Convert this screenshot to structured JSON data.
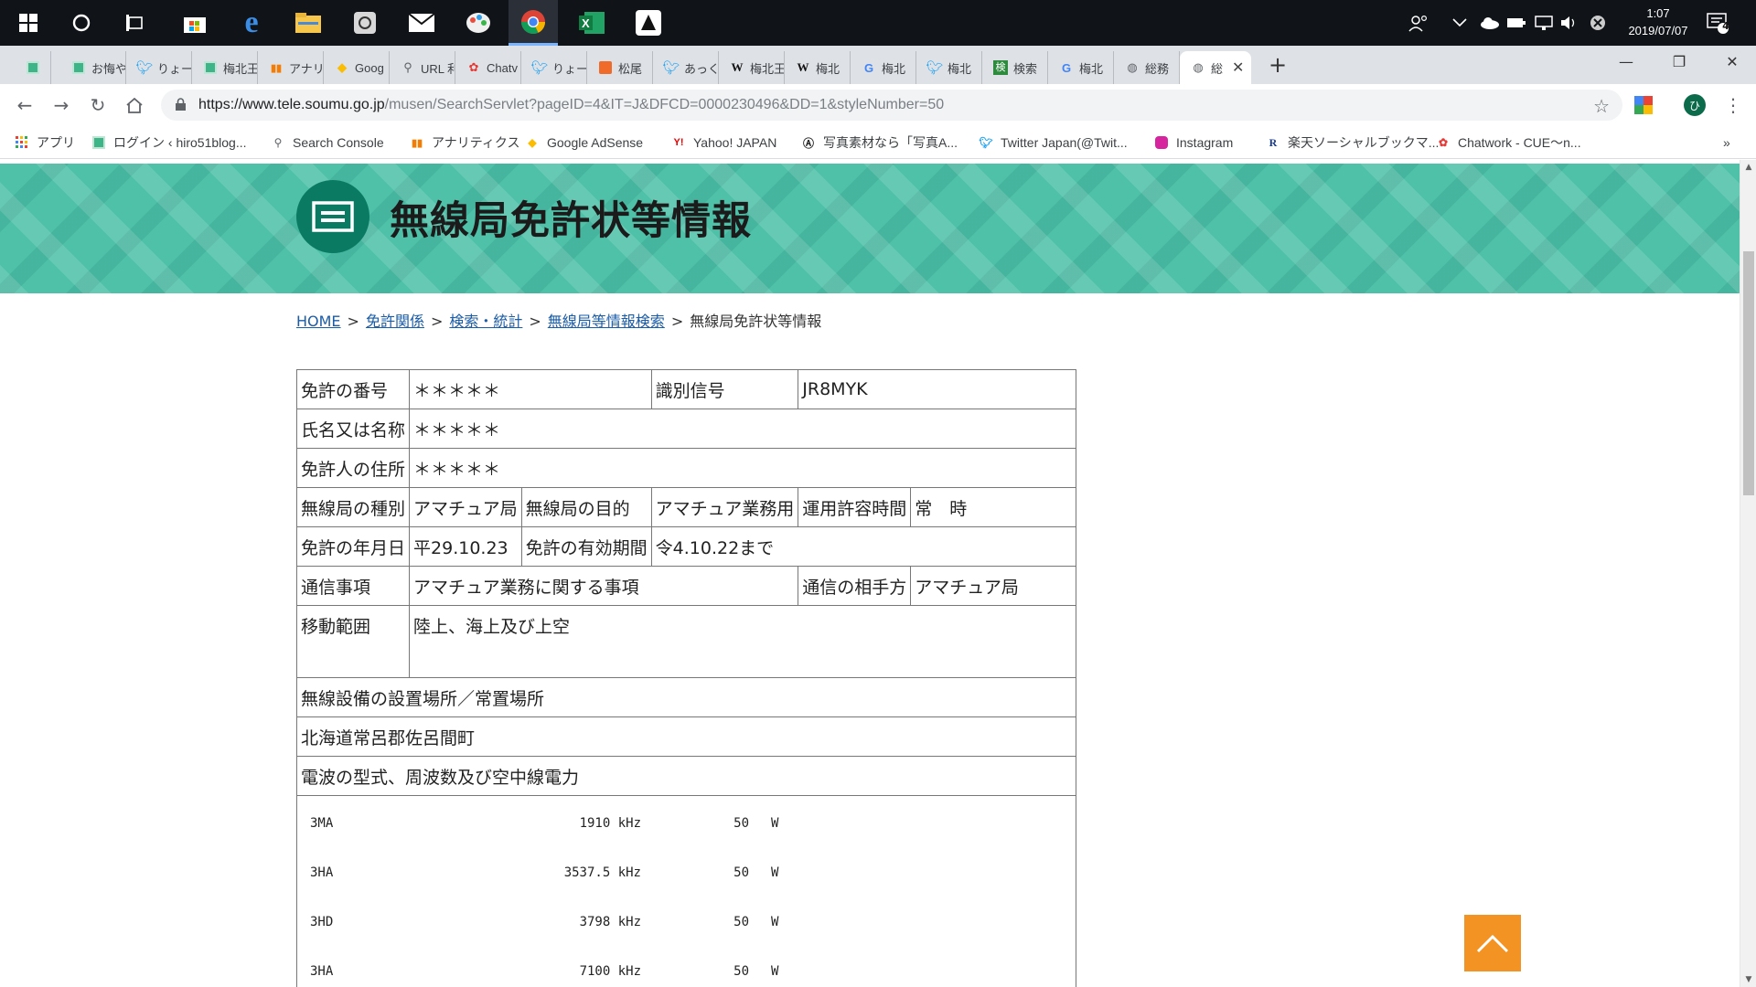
{
  "taskbar": {
    "clock_time": "1:07",
    "clock_date": "2019/07/07",
    "notification_count": "4",
    "apps": [
      "windows-start",
      "cortana",
      "task-view",
      "store",
      "edge",
      "explorer",
      "snipping",
      "mail",
      "paint",
      "chrome",
      "excel",
      "app"
    ]
  },
  "browser": {
    "tabs": [
      {
        "label": "",
        "icon": "green-square"
      },
      {
        "label": "お悔や",
        "icon": "green-square"
      },
      {
        "label": "りょーさ",
        "icon": "twitter"
      },
      {
        "label": "梅北王",
        "icon": "green-square"
      },
      {
        "label": "アナリテ",
        "icon": "analytics"
      },
      {
        "label": "Goog",
        "icon": "adsense"
      },
      {
        "label": "URL 利",
        "icon": "search-console"
      },
      {
        "label": "Chatv",
        "icon": "chatwork"
      },
      {
        "label": "りょー(",
        "icon": "twitter"
      },
      {
        "label": "松尾",
        "icon": "orange"
      },
      {
        "label": "あっく/",
        "icon": "twitter"
      },
      {
        "label": "梅北王",
        "icon": "wikipedia"
      },
      {
        "label": "梅北",
        "icon": "wikipedia"
      },
      {
        "label": "梅北",
        "icon": "google"
      },
      {
        "label": "梅北",
        "icon": "twitter"
      },
      {
        "label": "検索",
        "icon": "kensaku"
      },
      {
        "label": "梅北",
        "icon": "google"
      },
      {
        "label": "総務",
        "icon": "globe"
      },
      {
        "label": "総",
        "icon": "globe",
        "active": true
      }
    ],
    "new_tab_label": "+",
    "url_host": "https://www.tele.soumu.go.jp",
    "url_path": "/musen/SearchServlet?pageID=4&IT=J&DFCD=0000230496&DD=1&styleNumber=50",
    "profile_initial": "ひ",
    "bookmarks": [
      {
        "label": "アプリ",
        "icon": "apps"
      },
      {
        "label": "ログイン ‹ hiro51blog...",
        "icon": "green-square"
      },
      {
        "label": "Search Console",
        "icon": "search-console"
      },
      {
        "label": "アナリティクス",
        "icon": "analytics"
      },
      {
        "label": "Google AdSense",
        "icon": "adsense"
      },
      {
        "label": "Yahoo! JAPAN",
        "icon": "yahoo"
      },
      {
        "label": "写真素材なら「写真A...",
        "icon": "photo"
      },
      {
        "label": "Twitter Japan(@Twit...",
        "icon": "twitter"
      },
      {
        "label": "Instagram",
        "icon": "instagram"
      },
      {
        "label": "楽天ソーシャルブックマ...",
        "icon": "rakuten"
      },
      {
        "label": "Chatwork - CUE～n...",
        "icon": "chatwork"
      }
    ],
    "bookmarks_more": "»"
  },
  "page": {
    "title": "無線局免許状等情報",
    "breadcrumb": {
      "home": "HOME",
      "sep": ">",
      "menkyo": "免許関係",
      "kensaku": "検索・統計",
      "musenkyoku": "無線局等情報検索",
      "current": "無線局免許状等情報"
    },
    "license": {
      "number_label": "免許の番号",
      "number_value": "＊＊＊＊＊",
      "callsign_label": "識別信号",
      "callsign_value": "JR8MYK",
      "name_label": "氏名又は名称",
      "name_value": "＊＊＊＊＊",
      "address_label": "免許人の住所",
      "address_value": "＊＊＊＊＊",
      "type_label": "無線局の種別",
      "type_value": "アマチュア局",
      "purpose_label": "無線局の目的",
      "purpose_value": "アマチュア業務用",
      "hours_label": "運用許容時間",
      "hours_value": "常　時",
      "date_label": "免許の年月日",
      "date_value": "平29.10.23",
      "validity_label": "免許の有効期間",
      "validity_value": "令4.10.22まで",
      "comm_label": "通信事項",
      "comm_value": "アマチュア業務に関する事項",
      "partner_label": "通信の相手方",
      "partner_value": "アマチュア局",
      "range_label": "移動範囲",
      "range_value": "陸上、海上及び上空",
      "location_label": "無線設備の設置場所／常置場所",
      "location_value": "北海道常呂郡佐呂間町",
      "emission_label": "電波の型式、周波数及び空中線電力",
      "emissions": [
        {
          "type": "3MA",
          "freq": "1910 kHz",
          "power": "50",
          "unit": "W"
        },
        {
          "type": "3HA",
          "freq": "3537.5 kHz",
          "power": "50",
          "unit": "W"
        },
        {
          "type": "3HD",
          "freq": "3798 kHz",
          "power": "50",
          "unit": "W"
        },
        {
          "type": "3HA",
          "freq": "7100 kHz",
          "power": "50",
          "unit": "W"
        }
      ]
    }
  }
}
